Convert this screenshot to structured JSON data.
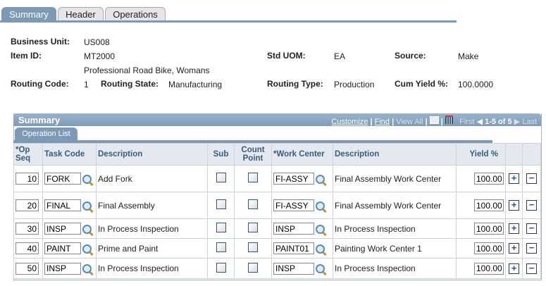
{
  "tabs": [
    {
      "label": "Summary"
    },
    {
      "label": "Header"
    },
    {
      "label": "Operations"
    }
  ],
  "header": {
    "business_unit_label": "Business Unit:",
    "business_unit": "US008",
    "item_id_label": "Item ID:",
    "item_id": "MT2000",
    "item_desc": "Professional Road Bike, Womans",
    "std_uom_label": "Std UOM:",
    "std_uom": "EA",
    "source_label": "Source:",
    "source": "Make",
    "routing_code_label": "Routing Code:",
    "routing_code": "1",
    "routing_state_label": "Routing State:",
    "routing_state": "Manufacturing",
    "routing_type_label": "Routing Type:",
    "routing_type": "Production",
    "cum_yield_label": "Cum Yield %:",
    "cum_yield": "100.0000"
  },
  "grid": {
    "title": "Summary",
    "customize": "Customize",
    "find": "Find",
    "view_all": "View All",
    "first": "First",
    "range": "1-5 of 5",
    "last": "Last",
    "sep": "|",
    "subtab": "Operation List",
    "columns": [
      "*Op Seq",
      "Task Code",
      "Description",
      "Sub",
      "Count Point",
      "*Work Center",
      "Description",
      "Yield %"
    ],
    "rows": [
      {
        "seq": "10",
        "task": "FORK",
        "desc": "Add Fork",
        "wc": "FI-ASSY",
        "wc_desc": "Final Assembly Work Center",
        "yield": "100.00"
      },
      {
        "seq": "20",
        "task": "FINAL",
        "desc": "Final Assembly",
        "wc": "FI-ASSY",
        "wc_desc": "Final Assembly Work Center",
        "yield": "100.00"
      },
      {
        "seq": "30",
        "task": "INSP",
        "desc": "In Process Inspection",
        "wc": "INSP",
        "wc_desc": "In Process Inspection",
        "yield": "100.00"
      },
      {
        "seq": "40",
        "task": "PAINT",
        "desc": "Prime and Paint",
        "wc": "PAINT01",
        "wc_desc": "Painting Work Center 1",
        "yield": "100.00"
      },
      {
        "seq": "50",
        "task": "INSP",
        "desc": "In Process Inspection",
        "wc": "INSP",
        "wc_desc": "In Process Inspection",
        "yield": "100.00"
      }
    ]
  }
}
